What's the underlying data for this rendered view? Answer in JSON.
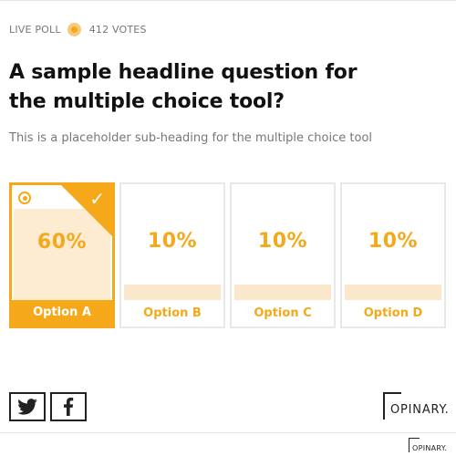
{
  "status": {
    "live_label": "LIVE POLL",
    "votes_label": "412 VOTES"
  },
  "headline": "A sample headline question for the multiple choice tool?",
  "subheading": "This is a placeholder sub-heading for the multiple choice tool",
  "options": [
    {
      "label": "Option A",
      "percent_text": "60%",
      "percent": 60,
      "selected": true
    },
    {
      "label": "Option B",
      "percent_text": "10%",
      "percent": 10,
      "selected": false
    },
    {
      "label": "Option C",
      "percent_text": "10%",
      "percent": 10,
      "selected": false
    },
    {
      "label": "Option D",
      "percent_text": "10%",
      "percent": 10,
      "selected": false
    }
  ],
  "share": {
    "twitter_icon": "twitter-icon",
    "facebook_icon": "facebook-icon"
  },
  "brand": {
    "logo_text": "OPINARY.",
    "footer_logo_text": "OPINARY."
  },
  "colors": {
    "accent": "#f5a91a",
    "fill_light": "#fbe7cb",
    "text_dark": "#111111",
    "text_muted": "#777777"
  }
}
